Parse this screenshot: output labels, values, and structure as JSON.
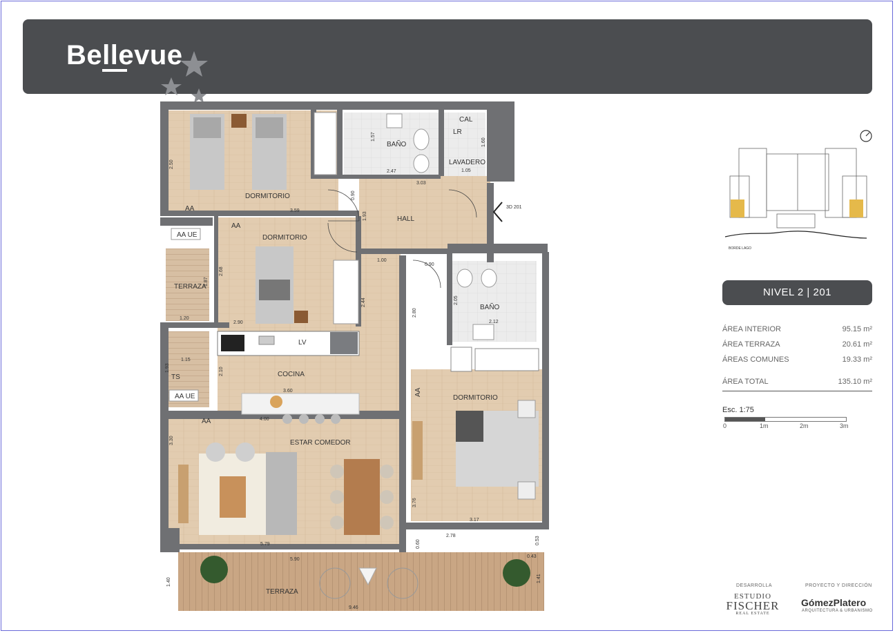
{
  "brand": {
    "name": "Bellevue"
  },
  "plan": {
    "rooms": {
      "dormitorio_1": "DORMITORIO",
      "bano_1": "BAÑO",
      "cal": "CAL",
      "lr": "LR",
      "lavadero": "LAVADERO",
      "hall": "HALL",
      "dormitorio_2": "DORMITORIO",
      "terraza_1": "TERRAZA",
      "bano_2": "BAÑO",
      "cocina": "COCINA",
      "lv": "LV",
      "ts": "TS",
      "dormitorio_3": "DORMITORIO",
      "estar_comedor": "ESTAR COMEDOR",
      "terraza_2": "TERRAZA"
    },
    "tags": {
      "aa_1": "AA",
      "aa_2": "AA",
      "aa_3": "AA",
      "aa_4": "AA",
      "aa_ue_1": "AA UE",
      "aa_ue_2": "AA UE",
      "view_ref": "3D\n201"
    },
    "dims": {
      "d_250": "2.50",
      "d_359": "3.59",
      "d_157": "1.57",
      "d_247": "2.47",
      "d_160": "1.60",
      "d_105": "1.05",
      "d_303": "3.03",
      "d_090a": "0.90",
      "d_193": "1.93",
      "d_268": "2.68",
      "d_187": "1.87",
      "d_290": "2.90",
      "d_120": "1.20",
      "d_100": "1.00",
      "d_244": "2.44",
      "d_090b": "0.90",
      "d_280": "2.80",
      "d_205": "2.05",
      "d_212": "2.12",
      "d_115": "1.15",
      "d_193b": "1.93",
      "d_210": "2.10",
      "d_360": "3.60",
      "d_400": "4.00",
      "d_330": "3.30",
      "d_376": "3.76",
      "d_317": "3.17",
      "d_278": "2.78",
      "d_579": "5.79",
      "d_590": "5.90",
      "d_060": "0.60",
      "d_053": "0.53",
      "d_043": "0.43",
      "d_140": "1.40",
      "d_141": "1.41",
      "d_946": "9.46"
    }
  },
  "key_map": {
    "caption": "BORDE LAGO"
  },
  "unit": {
    "label": "NIVEL 2 | 201"
  },
  "areas": [
    {
      "label": "ÁREA INTERIOR",
      "value": "95.15 m²"
    },
    {
      "label": "ÁREA TERRAZA",
      "value": "20.61 m²"
    },
    {
      "label": "ÁREAS COMUNES",
      "value": "19.33 m²"
    }
  ],
  "total": {
    "label": "ÁREA TOTAL",
    "value": "135.10 m²"
  },
  "scale": {
    "title": "Esc. 1:75",
    "ticks": [
      "0",
      "1m",
      "2m",
      "3m"
    ]
  },
  "credits": {
    "developer_label": "DESARROLLA",
    "developer_l1": "ESTUDIO",
    "developer_l2": "FISCHER",
    "developer_l3": "REAL ESTATE",
    "design_label": "PROYECTO Y DIRECCIÓN",
    "design_name": "GómezPlatero",
    "design_sub": "ARQUITECTURA & URBANISMO"
  },
  "colors": {
    "header": "#4b4d50",
    "wall": "#6f7073",
    "floor": "#e4cfb4",
    "tile": "#e6e6e6",
    "deck": "#caa988"
  }
}
